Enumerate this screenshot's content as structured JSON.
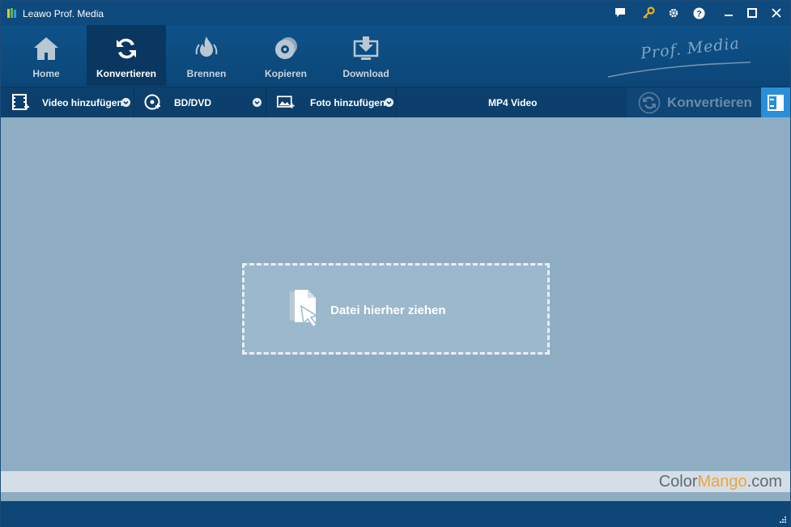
{
  "window": {
    "title": "Leawo Prof. Media"
  },
  "titlebar_buttons": [
    {
      "name": "feedback",
      "icon": "chat-icon"
    },
    {
      "name": "register",
      "icon": "key-icon"
    },
    {
      "name": "settings",
      "icon": "gear-icon"
    },
    {
      "name": "help",
      "icon": "help-icon"
    },
    {
      "name": "minimize",
      "icon": "minimize-icon"
    },
    {
      "name": "maximize",
      "icon": "maximize-icon"
    },
    {
      "name": "close",
      "icon": "close-icon"
    }
  ],
  "nav": {
    "items": [
      {
        "label": "Home",
        "icon": "home-icon",
        "active": false
      },
      {
        "label": "Konvertieren",
        "icon": "convert-icon",
        "active": true
      },
      {
        "label": "Brennen",
        "icon": "fire-icon",
        "active": false
      },
      {
        "label": "Kopieren",
        "icon": "disc-icon",
        "active": false
      },
      {
        "label": "Download",
        "icon": "download-icon",
        "active": false
      }
    ],
    "brand": "Prof. Media"
  },
  "toolbar": {
    "add_video": "Video hinzufügen",
    "bd_dvd": "BD/DVD",
    "add_photo": "Foto hinzufügen",
    "profile": "MP4 Video",
    "convert": "Konvertieren"
  },
  "dropzone": {
    "label": "Datei hierher ziehen"
  },
  "watermark": {
    "part1": "Color",
    "part2": "Mango",
    "part3": ".com"
  },
  "colors": {
    "titlebar": "#0f4a7e",
    "nav_active": "#0a3760",
    "content_bg": "#8eadc3",
    "accent_blue": "#2a8fd6",
    "key_icon": "#f2b01e"
  }
}
